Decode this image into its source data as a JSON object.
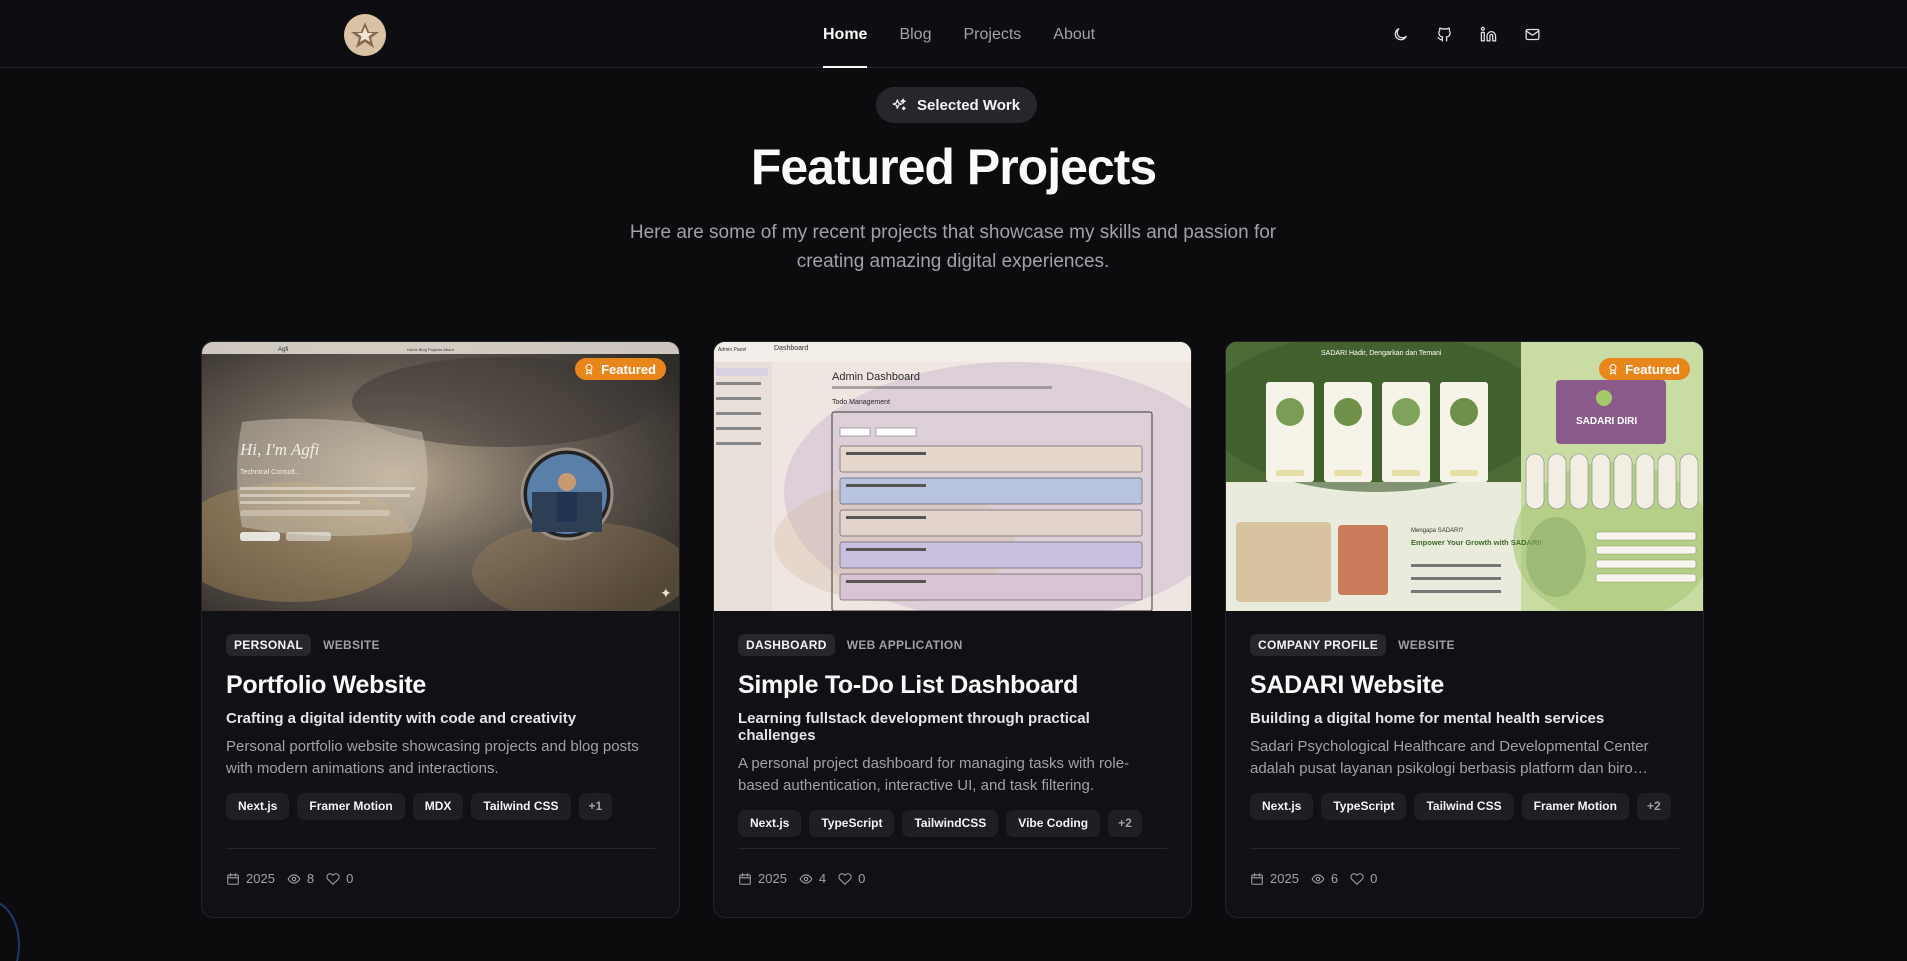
{
  "nav": {
    "links": [
      {
        "label": "Home",
        "active": true
      },
      {
        "label": "Blog",
        "active": false
      },
      {
        "label": "Projects",
        "active": false
      },
      {
        "label": "About",
        "active": false
      }
    ],
    "icons": [
      "moon-icon",
      "github-icon",
      "linkedin-icon",
      "mail-icon"
    ]
  },
  "hero": {
    "pill_label": "Selected Work",
    "title": "Featured Projects",
    "subtitle": "Here are some of my recent projects that showcase my skills and passion for creating amazing digital experiences."
  },
  "projects": [
    {
      "featured": true,
      "featured_label": "Featured",
      "category_primary": "PERSONAL",
      "category_secondary": "WEBSITE",
      "title": "Portfolio Website",
      "tagline": "Crafting a digital identity with code and creativity",
      "description": "Personal portfolio website showcasing projects and blog posts with modern animations and interactions.",
      "tags": [
        "Next.js",
        "Framer Motion",
        "MDX",
        "Tailwind CSS"
      ],
      "more_tags": "+1",
      "year": "2025",
      "views": "8",
      "likes": "0",
      "thumb_text": {
        "heading": "Hi, I'm Agfi",
        "subheading": "Technical Consult..."
      }
    },
    {
      "featured": false,
      "featured_label": "",
      "category_primary": "DASHBOARD",
      "category_secondary": "WEB APPLICATION",
      "title": "Simple To-Do List Dashboard",
      "tagline": "Learning fullstack development through practical challenges",
      "description": "A personal project dashboard for managing tasks with role-based authentication, interactive UI, and task filtering.",
      "tags": [
        "Next.js",
        "TypeScript",
        "TailwindCSS",
        "Vibe Coding"
      ],
      "more_tags": "+2",
      "year": "2025",
      "views": "4",
      "likes": "0",
      "thumb_text": {
        "heading": "Admin Dashboard",
        "subheading": "Todo Management"
      }
    },
    {
      "featured": true,
      "featured_label": "Featured",
      "category_primary": "COMPANY PROFILE",
      "category_secondary": "WEBSITE",
      "title": "SADARI Website",
      "tagline": "Building a digital home for mental health services",
      "description": "Sadari Psychological Healthcare and Developmental Center adalah pusat layanan psikologi berbasis platform dan biro yang...",
      "tags": [
        "Next.js",
        "TypeScript",
        "Tailwind CSS",
        "Framer Motion"
      ],
      "more_tags": "+2",
      "year": "2025",
      "views": "6",
      "likes": "0",
      "thumb_text": {
        "heading": "SADARI Hadir, Dengarkan dan Temani",
        "subheading": "Empower Your Growth with SADARI!"
      }
    }
  ]
}
